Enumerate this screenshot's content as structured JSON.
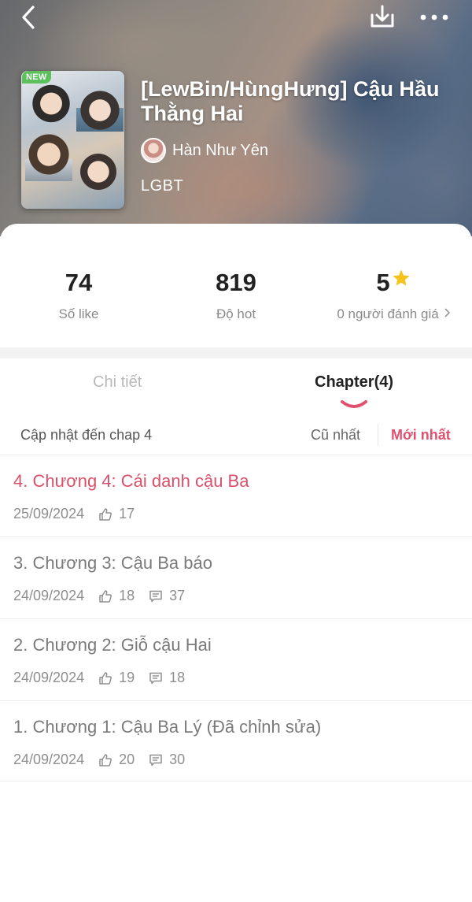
{
  "story": {
    "badge": "NEW",
    "title": "[LewBin/HùngHưng] Cậu Hầu Thằng Hai",
    "author": "Hàn Như Yên",
    "genre": "LGBT"
  },
  "stats": {
    "likes": {
      "value": "74",
      "label": "Số like"
    },
    "hot": {
      "value": "819",
      "label": "Độ hot"
    },
    "rating": {
      "value": "5",
      "label": "0 người đánh giá"
    }
  },
  "tabs": {
    "detail": "Chi tiết",
    "chapters": "Chapter(4)"
  },
  "sort": {
    "update_text": "Cập nhật đến chap 4",
    "oldest": "Cũ nhất",
    "newest": "Mới nhất"
  },
  "chapters": [
    {
      "title": "4. Chương 4: Cái danh cậu Ba",
      "date": "25/09/2024",
      "likes": "17",
      "comments": ""
    },
    {
      "title": "3. Chương 3: Cậu Ba báo",
      "date": "24/09/2024",
      "likes": "18",
      "comments": "37"
    },
    {
      "title": "2. Chương 2: Giỗ cậu Hai",
      "date": "24/09/2024",
      "likes": "19",
      "comments": "18"
    },
    {
      "title": "1. Chương 1: Cậu Ba Lý (Đã chỉnh sửa)",
      "date": "24/09/2024",
      "likes": "20",
      "comments": "30"
    }
  ],
  "colors": {
    "accent": "#d9506b",
    "new_badge": "#5cc15a",
    "star": "#f6c31c"
  },
  "icons": {
    "back": "chevron-left-icon",
    "download": "download-icon",
    "more": "more-dots-icon",
    "star": "star-icon",
    "like": "thumb-up-icon",
    "comment": "comment-icon"
  }
}
